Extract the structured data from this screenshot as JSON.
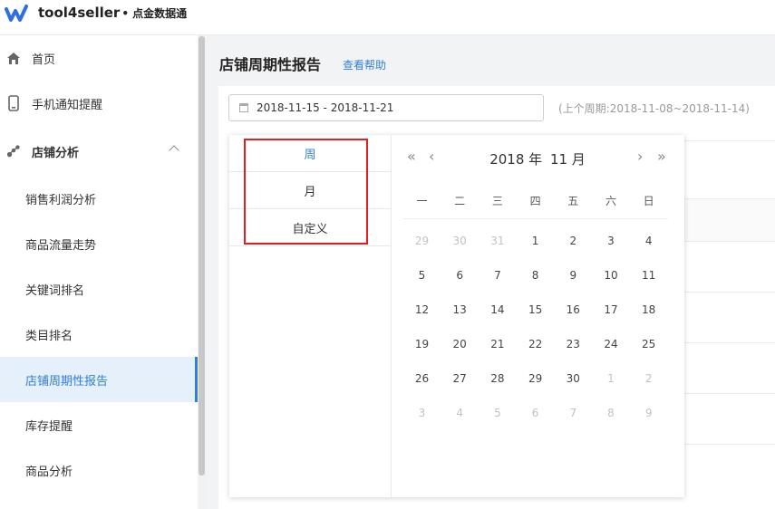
{
  "app": {
    "brand": "tool4seller",
    "brand_sub": "• 点金数据通",
    "logo_icon": "w-logo-icon"
  },
  "sidebar": {
    "home": "首页",
    "notify": "手机通知提醒",
    "shop_analysis": "店铺分析",
    "sub_items": [
      "销售利润分析",
      "商品流量走势",
      "关键词排名",
      "类目排名",
      "店铺周期性报告",
      "库存提醒",
      "商品分析"
    ],
    "active_index": 4
  },
  "page": {
    "title": "店铺周期性报告",
    "help": "查看帮助"
  },
  "filter": {
    "date_range": "2018-11-15 - 2018-11-21",
    "prev_period": "(上个周期:2018-11-08~2018-11-14)"
  },
  "picker": {
    "shortcuts": [
      "周",
      "月",
      "自定义"
    ],
    "active_shortcut": 0,
    "year": "2018 年",
    "month": "11 月",
    "nav": {
      "prev_year": "«",
      "prev_month": "‹",
      "next_month": "›",
      "next_year": "»"
    },
    "weekdays": [
      "一",
      "二",
      "三",
      "四",
      "五",
      "六",
      "日"
    ],
    "weeks": [
      [
        {
          "d": "29",
          "o": true
        },
        {
          "d": "30",
          "o": true
        },
        {
          "d": "31",
          "o": true
        },
        {
          "d": "1"
        },
        {
          "d": "2"
        },
        {
          "d": "3"
        },
        {
          "d": "4"
        }
      ],
      [
        {
          "d": "5"
        },
        {
          "d": "6"
        },
        {
          "d": "7"
        },
        {
          "d": "8"
        },
        {
          "d": "9"
        },
        {
          "d": "10"
        },
        {
          "d": "11"
        }
      ],
      [
        {
          "d": "12"
        },
        {
          "d": "13"
        },
        {
          "d": "14"
        },
        {
          "d": "15"
        },
        {
          "d": "16"
        },
        {
          "d": "17"
        },
        {
          "d": "18"
        }
      ],
      [
        {
          "d": "19"
        },
        {
          "d": "20"
        },
        {
          "d": "21"
        },
        {
          "d": "22"
        },
        {
          "d": "23"
        },
        {
          "d": "24"
        },
        {
          "d": "25"
        }
      ],
      [
        {
          "d": "26"
        },
        {
          "d": "27"
        },
        {
          "d": "28"
        },
        {
          "d": "29"
        },
        {
          "d": "30"
        },
        {
          "d": "1",
          "o": true
        },
        {
          "d": "2",
          "o": true
        }
      ],
      [
        {
          "d": "3",
          "o": true
        },
        {
          "d": "4",
          "o": true
        },
        {
          "d": "5",
          "o": true
        },
        {
          "d": "6",
          "o": true
        },
        {
          "d": "7",
          "o": true
        },
        {
          "d": "8",
          "o": true
        },
        {
          "d": "9",
          "o": true
        }
      ]
    ]
  },
  "colors": {
    "accent": "#2f7fd8",
    "highlight": "#e02020"
  }
}
